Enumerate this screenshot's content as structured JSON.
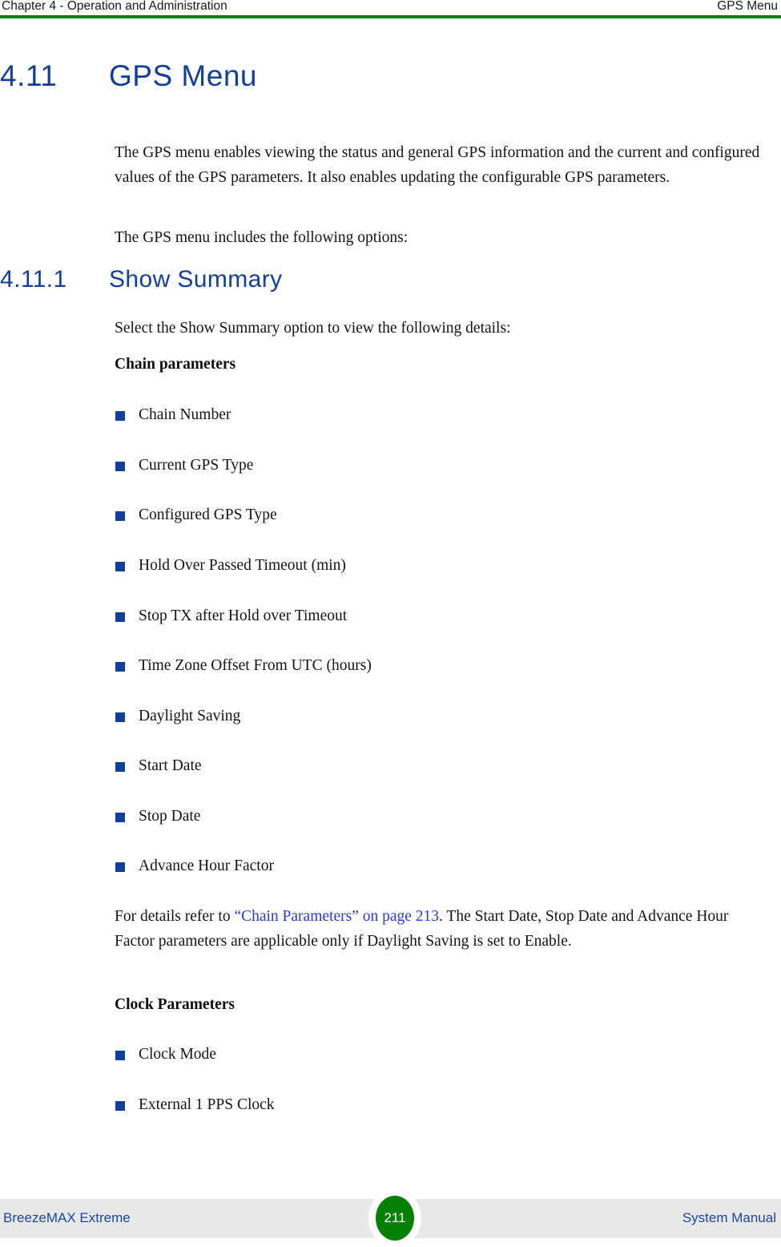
{
  "header": {
    "left": "Chapter 4 - Operation and Administration",
    "right": "GPS Menu",
    "rule_color": "#048104"
  },
  "section": {
    "number": "4.11",
    "title": "GPS Menu",
    "color": "#123f97"
  },
  "intro": {
    "paragraph1": "The GPS menu enables viewing the status and general GPS information and the current and configured values of the GPS parameters. It also enables updating the configurable GPS parameters.",
    "paragraph2": "The GPS menu includes the following options:"
  },
  "subsection": {
    "number": "4.11.1",
    "title": "Show Summary",
    "lead": "Select the Show Summary option to view the following details:"
  },
  "chain": {
    "heading": "Chain parameters",
    "items": [
      "Chain Number",
      "Current GPS Type",
      "Configured GPS Type",
      "Hold Over Passed Timeout (min)",
      "Stop TX after Hold over Timeout",
      "Time Zone Offset From UTC (hours)",
      "Daylight Saving",
      "Start Date",
      "Stop Date",
      "Advance Hour Factor"
    ]
  },
  "note": {
    "prefix": "For details refer to ",
    "link": "“Chain Parameters” on page 213",
    "suffix": ". The Start Date, Stop Date and Advance Hour Factor parameters are applicable only if Daylight Saving is set to Enable.",
    "link_color": "#2b39e0"
  },
  "clock": {
    "heading": "Clock Parameters",
    "items": [
      "Clock Mode",
      "External 1 PPS Clock"
    ]
  },
  "footer": {
    "left": "BreezeMAX Extreme",
    "right": "System Manual",
    "page_number": "211",
    "badge_color": "#048104",
    "band_color": "#e9e9e9"
  },
  "bullet": {
    "marker_color": "#123f97"
  }
}
